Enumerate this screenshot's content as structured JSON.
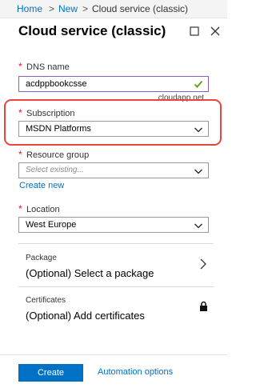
{
  "breadcrumb": {
    "home": "Home",
    "sep1": ">",
    "new": "New",
    "sep2": ">",
    "current": "Cloud service (classic)"
  },
  "blade": {
    "title": "Cloud service (classic)"
  },
  "icons": {
    "maximize": "maximize-icon",
    "close": "close-icon",
    "valid": "checkmark-icon",
    "chevron": "chevron-down-icon",
    "lock": "lock-icon"
  },
  "form": {
    "required_mark": "*",
    "dns": {
      "label": "DNS name",
      "value": "acdppbookcsse",
      "suffix": ".cloudapp.net"
    },
    "subscription": {
      "label": "Subscription",
      "value": "MSDN Platforms"
    },
    "resource_group": {
      "label": "Resource group",
      "placeholder": "Select existing...",
      "create_new": "Create new"
    },
    "location": {
      "label": "Location",
      "value": "West Europe"
    }
  },
  "sections": {
    "package": {
      "label": "Package",
      "value": "(Optional) Select a package"
    },
    "certificates": {
      "label": "Certificates",
      "value": "(Optional) Add certificates"
    }
  },
  "footer": {
    "create": "Create",
    "automation": "Automation options"
  },
  "colors": {
    "link": "#0072c6",
    "required": "#e81123",
    "active_border": "#8661c5",
    "highlight": "#e8463a",
    "valid": "#57a300"
  }
}
